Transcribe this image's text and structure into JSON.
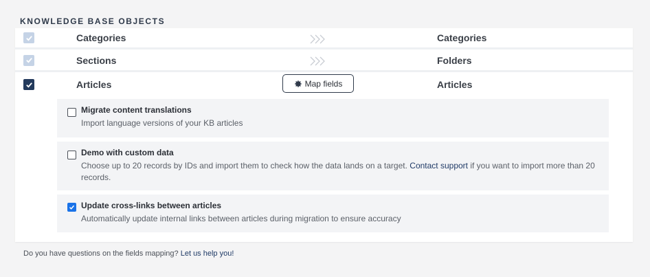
{
  "section_title": "KNOWLEDGE BASE OBJECTS",
  "rows": [
    {
      "source": "Categories",
      "target": "Categories",
      "checked": true,
      "disabled": true
    },
    {
      "source": "Sections",
      "target": "Folders",
      "checked": true,
      "disabled": true
    },
    {
      "source": "Articles",
      "target": "Articles",
      "checked": true,
      "disabled": false
    }
  ],
  "map_fields_label": "Map fields",
  "options": [
    {
      "title": "Migrate content translations",
      "description": "Import language versions of your KB articles",
      "checked": false
    },
    {
      "title": "Demo with custom data",
      "description_before": "Choose up to 20 records by IDs and import them to check how the data lands on a target.",
      "link": "Contact support",
      "description_after": "if you want to import more than 20 records.",
      "checked": false
    },
    {
      "title": "Update cross-links between articles",
      "description": "Automatically update internal links between articles during migration to ensure accuracy",
      "checked": true
    }
  ],
  "footer": {
    "text": "Do you have questions on the fields mapping?",
    "link": "Let us help you!"
  },
  "colors": {
    "checkbox_dark": "#233a5c",
    "checkbox_disabled": "#c5d3e6",
    "checkbox_blue": "#1a73e8"
  }
}
